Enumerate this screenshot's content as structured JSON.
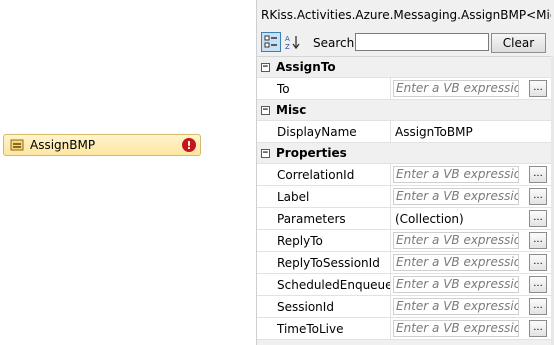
{
  "activity": {
    "label": "AssignBMP",
    "error_glyph": "!"
  },
  "panel": {
    "title": "RKiss.Activities.Azure.Messaging.AssignBMP<Micros...",
    "search_label": "Search:",
    "search_value": "",
    "clear_label": "Clear"
  },
  "categories": [
    {
      "name": "AssignTo",
      "expander": "−",
      "props": [
        {
          "name": "To",
          "kind": "expr",
          "value": "Enter a VB expression",
          "button": "..."
        }
      ]
    },
    {
      "name": "Misc",
      "expander": "−",
      "props": [
        {
          "name": "DisplayName",
          "kind": "text",
          "value": "AssignToBMP"
        }
      ]
    },
    {
      "name": "Properties",
      "expander": "−",
      "props": [
        {
          "name": "CorrelationId",
          "kind": "expr",
          "value": "Enter a VB expression",
          "button": "..."
        },
        {
          "name": "Label",
          "kind": "expr",
          "value": "Enter a VB expression",
          "button": "..."
        },
        {
          "name": "Parameters",
          "kind": "text",
          "value": "(Collection)",
          "button": "..."
        },
        {
          "name": "ReplyTo",
          "kind": "expr",
          "value": "Enter a VB expression",
          "button": "..."
        },
        {
          "name": "ReplyToSessionId",
          "kind": "expr",
          "value": "Enter a VB expression",
          "button": "..."
        },
        {
          "name": "ScheduledEnqueue...",
          "kind": "expr",
          "value": "Enter a VB expression",
          "button": "..."
        },
        {
          "name": "SessionId",
          "kind": "expr",
          "value": "Enter a VB expression",
          "button": "..."
        },
        {
          "name": "TimeToLive",
          "kind": "expr",
          "value": "Enter a VB expression",
          "button": "..."
        }
      ]
    }
  ]
}
